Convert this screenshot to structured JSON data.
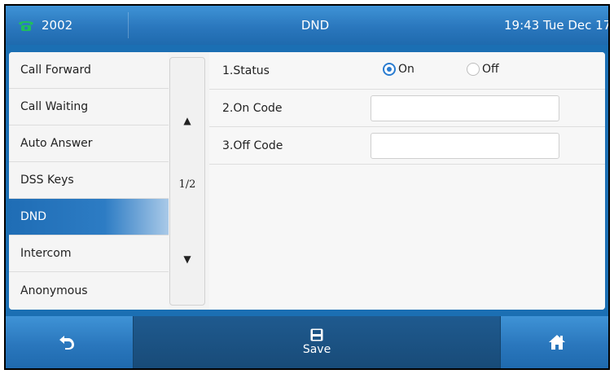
{
  "status_bar": {
    "line": "2002",
    "title": "DND",
    "datetime": "19:43 Tue Dec 17"
  },
  "menu": {
    "items": [
      {
        "label": "Call Forward"
      },
      {
        "label": "Call Waiting"
      },
      {
        "label": "Auto Answer"
      },
      {
        "label": "DSS Keys"
      },
      {
        "label": "DND"
      },
      {
        "label": "Intercom"
      },
      {
        "label": "Anonymous"
      }
    ],
    "active_index": 4
  },
  "pager": {
    "page": "1/2"
  },
  "settings": {
    "status_label": "1.Status",
    "on_label": "On",
    "off_label": "Off",
    "selected": "On",
    "on_code_label": "2.On Code",
    "on_code_value": "",
    "off_code_label": "3.Off Code",
    "off_code_value": ""
  },
  "softkeys": {
    "save_label": "Save"
  },
  "colors": {
    "bar_blue": "#2a77bd",
    "active_item": "#1f6db5",
    "radio_on": "#2a7cd0",
    "phone_icon": "#1fbf5b"
  },
  "icons": {
    "line": "phone-icon",
    "back": "back-arrow-icon",
    "save": "floppy-disk-icon",
    "home": "home-icon"
  }
}
